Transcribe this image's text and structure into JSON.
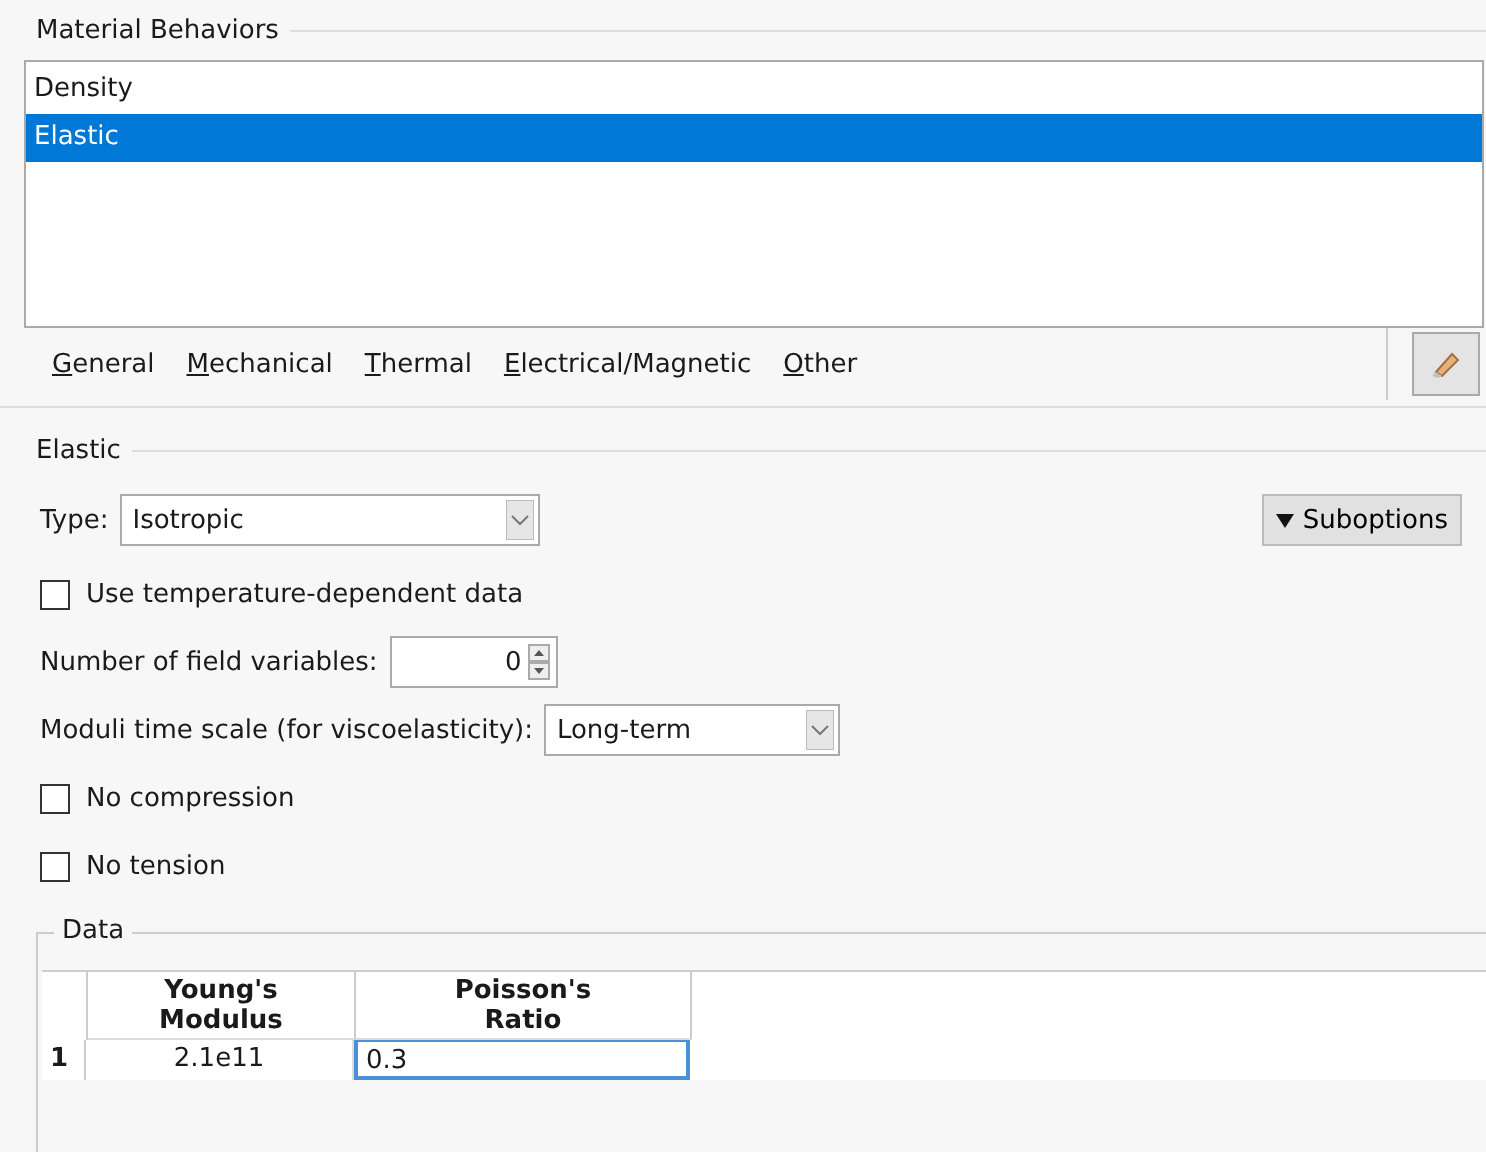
{
  "behaviors": {
    "title": "Material Behaviors",
    "items": [
      {
        "label": "Density",
        "selected": false
      },
      {
        "label": "Elastic",
        "selected": true
      }
    ]
  },
  "menu": [
    "General",
    "Mechanical",
    "Thermal",
    "Electrical/Magnetic",
    "Other"
  ],
  "elastic": {
    "title": "Elastic",
    "type_label": "Type:",
    "type_value": "Isotropic",
    "suboptions": "Suboptions",
    "use_temperature": {
      "label": "Use temperature-dependent data",
      "checked": false
    },
    "field_vars_label": "Number of field variables:",
    "field_vars_value": "0",
    "moduli_label": "Moduli time scale (for viscoelasticity):",
    "moduli_value": "Long-term",
    "no_compression": {
      "label": "No compression",
      "checked": false
    },
    "no_tension": {
      "label": "No tension",
      "checked": false
    }
  },
  "data": {
    "title": "Data",
    "columns": [
      "Young's Modulus",
      "Poisson's Ratio"
    ],
    "rows": [
      {
        "index": "1",
        "cells": [
          "2.1e11",
          "0.3"
        ]
      }
    ]
  }
}
